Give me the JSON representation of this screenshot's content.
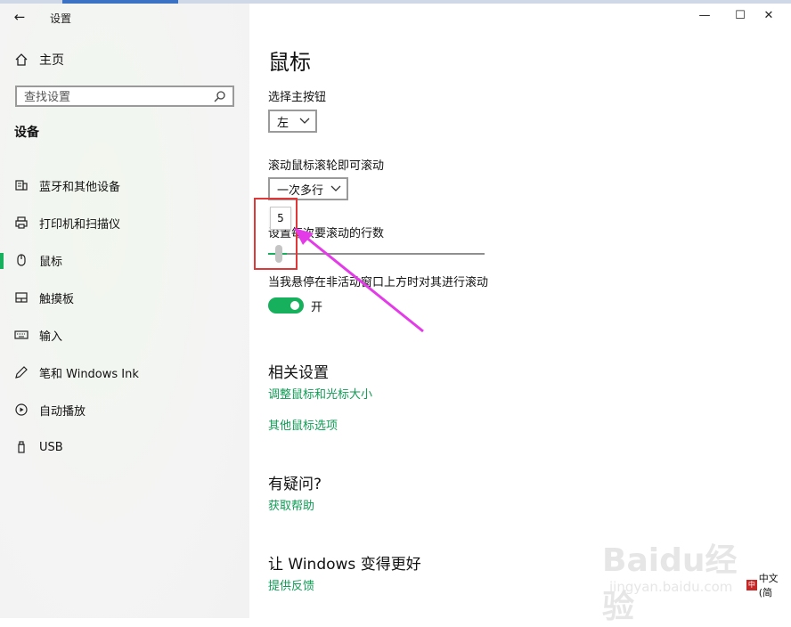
{
  "app": {
    "title": "设置"
  },
  "window": {
    "minimize_glyph": "—",
    "maximize_glyph": "☐",
    "close_glyph": "✕"
  },
  "sidebar": {
    "back_glyph": "←",
    "home_label": "主页",
    "search_placeholder": "查找设置",
    "section_heading": "设备",
    "items": [
      {
        "label": "蓝牙和其他设备",
        "icon": "bluetooth-devices-icon",
        "selected": false
      },
      {
        "label": "打印机和扫描仪",
        "icon": "printer-icon",
        "selected": false
      },
      {
        "label": "鼠标",
        "icon": "mouse-icon",
        "selected": true
      },
      {
        "label": "触摸板",
        "icon": "touchpad-icon",
        "selected": false
      },
      {
        "label": "输入",
        "icon": "keyboard-icon",
        "selected": false
      },
      {
        "label": "笔和 Windows Ink",
        "icon": "pen-icon",
        "selected": false
      },
      {
        "label": "自动播放",
        "icon": "autoplay-icon",
        "selected": false
      },
      {
        "label": "USB",
        "icon": "usb-icon",
        "selected": false
      }
    ]
  },
  "main": {
    "title": "鼠标",
    "primary_button": {
      "label": "选择主按钮",
      "value": "左"
    },
    "scroll_mode": {
      "label": "滚动鼠标滚轮即可滚动",
      "value": "一次多行"
    },
    "lines_slider": {
      "label": "设置每次要滚动的行数",
      "value": "5",
      "min": 1,
      "max": 100,
      "current": 5
    },
    "inactive_scroll": {
      "label": "当我悬停在非活动窗口上方时对其进行滚动",
      "state": "开",
      "on": true
    },
    "related": {
      "heading": "相关设置",
      "links": [
        "调整鼠标和光标大小",
        "其他鼠标选项"
      ]
    },
    "help": {
      "heading": "有疑问?",
      "link": "获取帮助"
    },
    "feedback": {
      "heading": "让 Windows 变得更好",
      "link": "提供反馈"
    }
  },
  "annotation": {
    "color": "#e03838",
    "arrow_color": "#e33be8"
  },
  "watermark": {
    "big": "Baidu经验",
    "small": "jingyan.baidu.com"
  },
  "ime": {
    "mark": "中",
    "label": "中文(简"
  },
  "colors": {
    "accent": "#17b05d",
    "link": "#0f9b54"
  }
}
